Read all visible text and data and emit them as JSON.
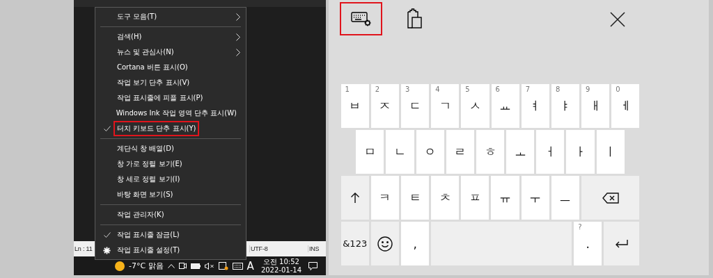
{
  "editor": {
    "status_bar": {
      "line": "Ln : 11",
      "encoding": "UTF-8",
      "mode": "INS"
    }
  },
  "menu": {
    "items": [
      {
        "kind": "item",
        "label": "도구 모음(T)",
        "checked": false,
        "submenu": true,
        "highlighted": false
      },
      {
        "kind": "separator"
      },
      {
        "kind": "item",
        "label": "검색(H)",
        "checked": false,
        "submenu": true,
        "highlighted": false
      },
      {
        "kind": "item",
        "label": "뉴스 및 관심사(N)",
        "checked": false,
        "submenu": true,
        "highlighted": false
      },
      {
        "kind": "item",
        "label": "Cortana 버튼 표시(O)",
        "checked": false,
        "submenu": false,
        "highlighted": false
      },
      {
        "kind": "item",
        "label": "작업 보기 단추 표시(V)",
        "checked": false,
        "submenu": false,
        "highlighted": false
      },
      {
        "kind": "item",
        "label": "작업 표시줄에 피플 표시(P)",
        "checked": false,
        "submenu": false,
        "highlighted": false
      },
      {
        "kind": "item",
        "label": "Windows Ink 작업 영역 단추 표시(W)",
        "checked": false,
        "submenu": false,
        "highlighted": false
      },
      {
        "kind": "item",
        "label": "터치 키보드 단추 표시(Y)",
        "checked": true,
        "submenu": false,
        "highlighted": true
      },
      {
        "kind": "separator"
      },
      {
        "kind": "item",
        "label": "계단식 창 배열(D)",
        "checked": false,
        "submenu": false,
        "highlighted": false
      },
      {
        "kind": "item",
        "label": "창 가로 정렬 보기(E)",
        "checked": false,
        "submenu": false,
        "highlighted": false
      },
      {
        "kind": "item",
        "label": "창 세로 정렬 보기(I)",
        "checked": false,
        "submenu": false,
        "highlighted": false
      },
      {
        "kind": "item",
        "label": "바탕 화면 보기(S)",
        "checked": false,
        "submenu": false,
        "highlighted": false
      },
      {
        "kind": "separator"
      },
      {
        "kind": "item",
        "label": "작업 관리자(K)",
        "checked": false,
        "submenu": false,
        "highlighted": false
      },
      {
        "kind": "separator"
      },
      {
        "kind": "item",
        "label": "작업 표시줄 잠금(L)",
        "checked": true,
        "submenu": false,
        "highlighted": false
      },
      {
        "kind": "gear-item",
        "label": "작업 표시줄 설정(T)",
        "checked": false,
        "submenu": false,
        "highlighted": false
      }
    ]
  },
  "taskbar": {
    "weather": "-7°C 맑음",
    "input_mode": "A",
    "time": "오전 10:52",
    "date": "2022-01-14"
  },
  "keyboard": {
    "tools": [
      {
        "kind": "settings",
        "highlighted": true
      },
      {
        "kind": "clipboard",
        "highlighted": false
      }
    ],
    "rows": [
      {
        "keys": [
          {
            "kind": "letter",
            "label": "ㅂ",
            "hint": "1"
          },
          {
            "kind": "letter",
            "label": "ㅈ",
            "hint": "2"
          },
          {
            "kind": "letter",
            "label": "ㄷ",
            "hint": "3"
          },
          {
            "kind": "letter",
            "label": "ㄱ",
            "hint": "4"
          },
          {
            "kind": "letter",
            "label": "ㅅ",
            "hint": "5"
          },
          {
            "kind": "letter",
            "label": "ㅛ",
            "hint": "6"
          },
          {
            "kind": "letter",
            "label": "ㅕ",
            "hint": "7"
          },
          {
            "kind": "letter",
            "label": "ㅑ",
            "hint": "8"
          },
          {
            "kind": "letter",
            "label": "ㅐ",
            "hint": "9"
          },
          {
            "kind": "letter",
            "label": "ㅔ",
            "hint": "0"
          }
        ]
      },
      {
        "keys": [
          {
            "kind": "letter",
            "label": "ㅁ"
          },
          {
            "kind": "letter",
            "label": "ㄴ"
          },
          {
            "kind": "letter",
            "label": "ㅇ"
          },
          {
            "kind": "letter",
            "label": "ㄹ"
          },
          {
            "kind": "letter",
            "label": "ㅎ"
          },
          {
            "kind": "letter",
            "label": "ㅗ"
          },
          {
            "kind": "letter",
            "label": "ㅓ"
          },
          {
            "kind": "letter",
            "label": "ㅏ"
          },
          {
            "kind": "letter",
            "label": "ㅣ"
          }
        ]
      },
      {
        "keys": [
          {
            "kind": "shift"
          },
          {
            "kind": "letter",
            "label": "ㅋ"
          },
          {
            "kind": "letter",
            "label": "ㅌ"
          },
          {
            "kind": "letter",
            "label": "ㅊ"
          },
          {
            "kind": "letter",
            "label": "ㅍ"
          },
          {
            "kind": "letter",
            "label": "ㅠ"
          },
          {
            "kind": "letter",
            "label": "ㅜ"
          },
          {
            "kind": "letter",
            "label": "ㅡ"
          },
          {
            "kind": "backspace"
          }
        ]
      },
      {
        "keys": [
          {
            "kind": "symbols",
            "label": "&123"
          },
          {
            "kind": "emoji"
          },
          {
            "kind": "letter",
            "label": ","
          },
          {
            "kind": "space"
          },
          {
            "kind": "letter",
            "label": ".",
            "hint": "?"
          },
          {
            "kind": "enter"
          }
        ]
      }
    ]
  }
}
